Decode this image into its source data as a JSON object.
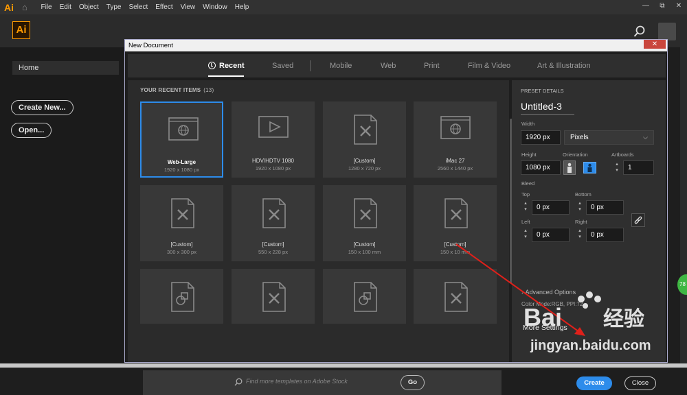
{
  "app": {
    "logo_text": "Ai",
    "small_logo_text": "Ai"
  },
  "menu": [
    "File",
    "Edit",
    "Object",
    "Type",
    "Select",
    "Effect",
    "View",
    "Window",
    "Help"
  ],
  "window_controls": {
    "minimize": "—",
    "restore": "⧉",
    "close": "✕"
  },
  "sidebar": {
    "home": "Home",
    "create_new": "Create New...",
    "open": "Open..."
  },
  "dialog": {
    "title": "New Document",
    "close": "✕",
    "tabs": [
      "Recent",
      "Saved",
      "Mobile",
      "Web",
      "Print",
      "Film & Video",
      "Art & Illustration"
    ],
    "recent_heading": "YOUR RECENT ITEMS",
    "recent_count": "(13)",
    "cards": [
      {
        "name": "Web-Large",
        "size": "1920 x 1080 px",
        "icon": "web-globe-icon",
        "selected": true
      },
      {
        "name": "HDV/HDTV 1080",
        "size": "1920 x 1080 px",
        "icon": "video-play-icon"
      },
      {
        "name": "[Custom]",
        "size": "1280 x 720 px",
        "icon": "custom-doc-icon"
      },
      {
        "name": "iMac 27",
        "size": "2560 x 1440 px",
        "icon": "web-globe-icon"
      },
      {
        "name": "[Custom]",
        "size": "300 x 300 px",
        "icon": "custom-doc-icon"
      },
      {
        "name": "[Custom]",
        "size": "550 x 228 px",
        "icon": "custom-doc-icon"
      },
      {
        "name": "[Custom]",
        "size": "150 x 100 mm",
        "icon": "custom-doc-icon"
      },
      {
        "name": "[Custom]",
        "size": "150 x 10 mm",
        "icon": "custom-doc-icon"
      },
      {
        "name": "",
        "size": "",
        "icon": "art-shapes-icon"
      },
      {
        "name": "",
        "size": "",
        "icon": "custom-doc-icon"
      },
      {
        "name": "",
        "size": "",
        "icon": "art-shapes-icon"
      },
      {
        "name": "",
        "size": "",
        "icon": "custom-doc-icon"
      }
    ],
    "stock_placeholder": "Find more templates on Adobe Stock",
    "go": "Go"
  },
  "preset": {
    "heading": "PRESET DETAILS",
    "name": "Untitled-3",
    "width_label": "Width",
    "width": "1920 px",
    "units": "Pixels",
    "height_label": "Height",
    "height": "1080 px",
    "orientation_label": "Orientation",
    "artboards_label": "Artboards",
    "artboards": "1",
    "bleed_label": "Bleed",
    "top_label": "Top",
    "top": "0 px",
    "bottom_label": "Bottom",
    "bottom": "0 px",
    "left_label": "Left",
    "left": "0 px",
    "right_label": "Right",
    "right": "0 px",
    "advanced": "Advanced Options",
    "color_mode": "Color Mode:RGB, PPI:72",
    "more_settings": "More Settings",
    "create": "Create",
    "close": "Close"
  },
  "side_badge": "78",
  "colors": {
    "accent": "#2d8ceb",
    "ai_orange": "#ff9a00",
    "annotation_red": "#e0201a"
  }
}
